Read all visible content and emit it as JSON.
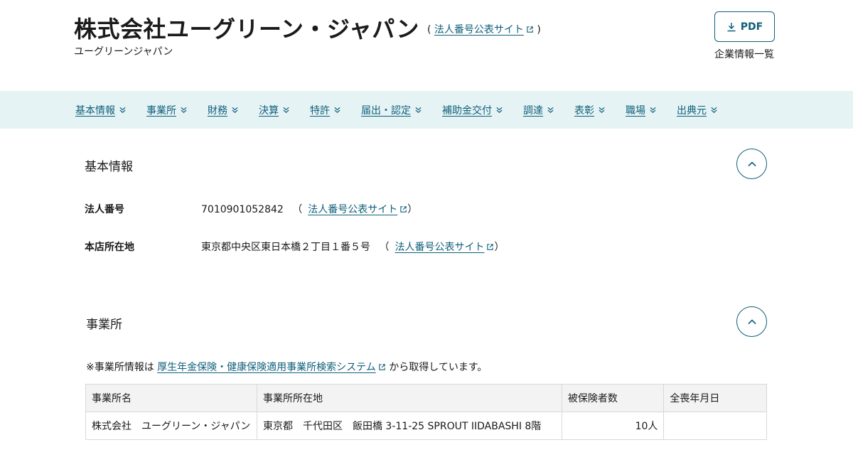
{
  "header": {
    "company_name": "株式会社ユーグリーン・ジャパン",
    "paren_open": "(",
    "corp_link": "法人番号公表サイト",
    "paren_close": ")",
    "company_kana": "ユーグリーンジャパン",
    "pdf_label": "PDF",
    "pdf_caption": "企業情報一覧"
  },
  "nav": {
    "items": [
      "基本情報",
      "事業所",
      "財務",
      "決算",
      "特許",
      "届出・認定",
      "補助金交付",
      "調達",
      "表彰",
      "職場",
      "出典元"
    ]
  },
  "basic": {
    "title": "基本情報",
    "corp_number_label": "法人番号",
    "corp_number_value": "7010901052842",
    "address_label": "本店所在地",
    "address_value": "東京都中央区東日本橋２丁目１番５号",
    "link_text": "法人番号公表サイト",
    "paren_open": "（",
    "paren_close": "）"
  },
  "offices": {
    "title": "事業所",
    "note_prefix": "※事業所情報は",
    "note_link": "厚生年金保険・健康保険適用事業所検索システム",
    "note_suffix": "から取得しています。",
    "columns": [
      "事業所名",
      "事業所所在地",
      "被保険者数",
      "全喪年月日"
    ],
    "rows": [
      [
        "株式会社　ユーグリーン・ジャパン",
        "東京都　千代田区　飯田橋 3-11-25 SPROUT IIDABASHI 8階",
        "10人",
        ""
      ]
    ]
  },
  "colors": {
    "accent": "#0f5f7a",
    "nav_bg": "#e5f3f5",
    "table_header_bg": "#f3f3f3"
  },
  "icons": [
    "external-link-icon",
    "download-icon",
    "double-chevron-down-icon",
    "chevron-up-icon"
  ]
}
